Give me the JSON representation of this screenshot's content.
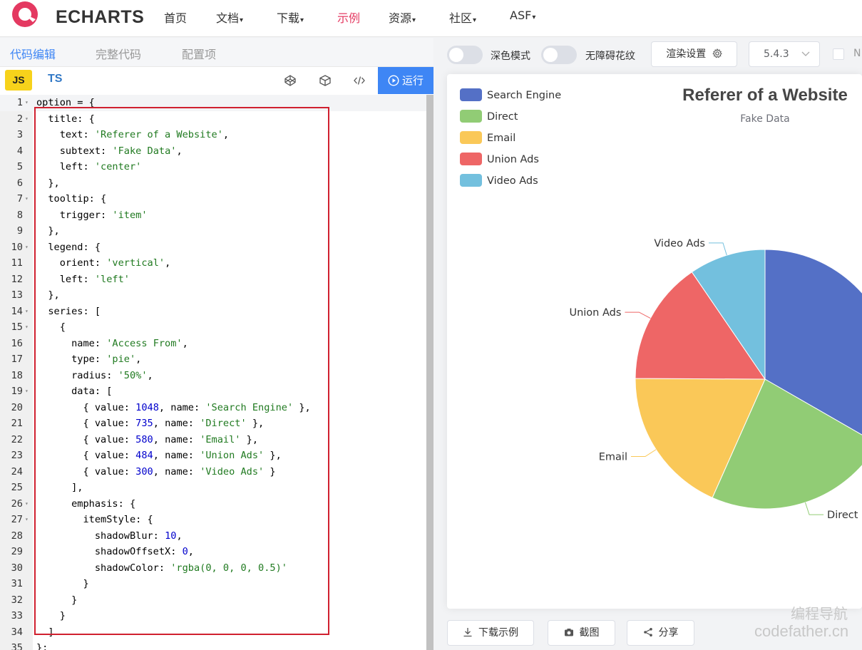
{
  "brand": {
    "logo_text": "ECHARTS",
    "accent": "#e43961"
  },
  "nav": {
    "items": [
      {
        "label": "首页",
        "caret": false
      },
      {
        "label": "文档",
        "caret": true
      },
      {
        "label": "下载",
        "caret": true
      },
      {
        "label": "示例",
        "caret": false,
        "active": true
      },
      {
        "label": "资源",
        "caret": true
      },
      {
        "label": "社区",
        "caret": true
      },
      {
        "label": "ASF",
        "caret": true
      }
    ],
    "caret_glyph": "▾"
  },
  "editor": {
    "tabs": [
      "代码编辑",
      "完整代码",
      "配置项"
    ],
    "lang_js": "JS",
    "lang_ts": "TS",
    "run_label": "运行",
    "lines": [
      "option = {",
      "  title: {",
      "    text: 'Referer of a Website',",
      "    subtext: 'Fake Data',",
      "    left: 'center'",
      "  },",
      "  tooltip: {",
      "    trigger: 'item'",
      "  },",
      "  legend: {",
      "    orient: 'vertical',",
      "    left: 'left'",
      "  },",
      "  series: [",
      "    {",
      "      name: 'Access From',",
      "      type: 'pie',",
      "      radius: '50%',",
      "      data: [",
      "        { value: 1048, name: 'Search Engine' },",
      "        { value: 735, name: 'Direct' },",
      "        { value: 580, name: 'Email' },",
      "        { value: 484, name: 'Union Ads' },",
      "        { value: 300, name: 'Video Ads' }",
      "      ],",
      "      emphasis: {",
      "        itemStyle: {",
      "          shadowBlur: 10,",
      "          shadowOffsetX: 0,",
      "          shadowColor: 'rgba(0, 0, 0, 0.5)'",
      "        }",
      "      }",
      "    }",
      "  ]",
      "};"
    ],
    "fold_lines": [
      1,
      2,
      7,
      10,
      14,
      15,
      19,
      26,
      27
    ],
    "fold_glyph": "▾"
  },
  "preview": {
    "dark_mode_label": "深色模式",
    "a11y_label": "无障碍花纹",
    "render_label": "渲染设置",
    "version": "5.4.3",
    "checkbox_label": "N",
    "download_label": "下载示例",
    "screenshot_label": "截图",
    "share_label": "分享"
  },
  "watermark": {
    "line1": "编程导航",
    "line2": "codefather.cn"
  },
  "chart_data": {
    "type": "pie",
    "title": "Referer of a Website",
    "subtitle": "Fake Data",
    "legend_placement": "top-left",
    "legend_orient": "vertical",
    "radius": "50%",
    "series": [
      {
        "data": [
          {
            "name": "Search Engine",
            "value": 1048,
            "color": "#5470c6"
          },
          {
            "name": "Direct",
            "value": 735,
            "color": "#91cc75"
          },
          {
            "name": "Email",
            "value": 580,
            "color": "#fac858"
          },
          {
            "name": "Union Ads",
            "value": 484,
            "color": "#ee6666"
          },
          {
            "name": "Video Ads",
            "value": 300,
            "color": "#73c0de"
          }
        ]
      }
    ]
  }
}
